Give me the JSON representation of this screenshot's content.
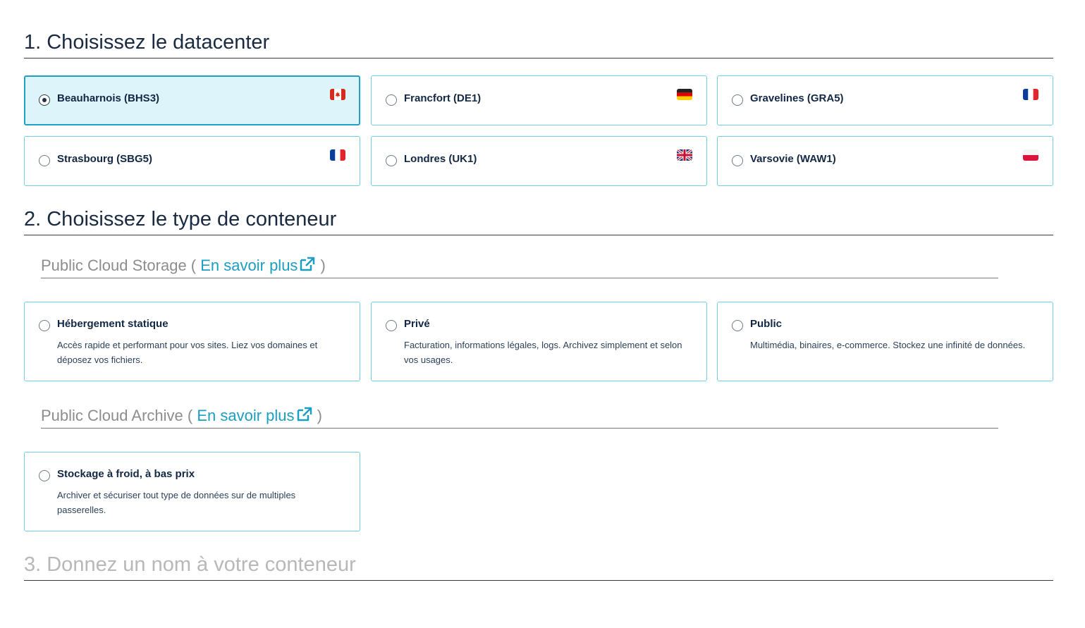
{
  "steps": {
    "datacenter_title": "1. Choisissez le datacenter",
    "container_title": "2. Choisissez le type de conteneur",
    "name_title": "3. Donnez un nom à votre conteneur"
  },
  "datacenters": [
    {
      "label": "Beauharnois (BHS3)",
      "flag": "canada-flag-icon",
      "selected": true
    },
    {
      "label": "Francfort (DE1)",
      "flag": "germany-flag-icon",
      "selected": false
    },
    {
      "label": "Gravelines (GRA5)",
      "flag": "france-flag-icon",
      "selected": false
    },
    {
      "label": "Strasbourg (SBG5)",
      "flag": "france-flag-icon",
      "selected": false
    },
    {
      "label": "Londres (UK1)",
      "flag": "uk-flag-icon",
      "selected": false
    },
    {
      "label": "Varsovie (WAW1)",
      "flag": "poland-flag-icon",
      "selected": false
    }
  ],
  "groups": {
    "storage": {
      "title": "Public Cloud Storage",
      "open_paren": " ( ",
      "link": "En savoir plus",
      "close_paren": " )"
    },
    "archive": {
      "title": "Public Cloud Archive",
      "open_paren": " ( ",
      "link": "En savoir plus",
      "close_paren": " )"
    }
  },
  "container_types": [
    {
      "title": "Hébergement statique",
      "desc": "Accès rapide et performant pour vos sites. Liez vos domaines et déposez vos fichiers."
    },
    {
      "title": "Privé",
      "desc": "Facturation, informations légales, logs. Archivez simplement et selon vos usages."
    },
    {
      "title": "Public",
      "desc": "Multimédia, binaires, e-commerce. Stockez une infinité de données."
    },
    {
      "title": "Stockage à froid, à bas prix",
      "desc": "Archiver et sécuriser tout type de données sur de multiples passerelles."
    }
  ],
  "colors": {
    "accent": "#1fa1c3",
    "card_border": "#6fd0e3",
    "selected_bg": "#def4fb",
    "link": "#1b9ec1"
  }
}
